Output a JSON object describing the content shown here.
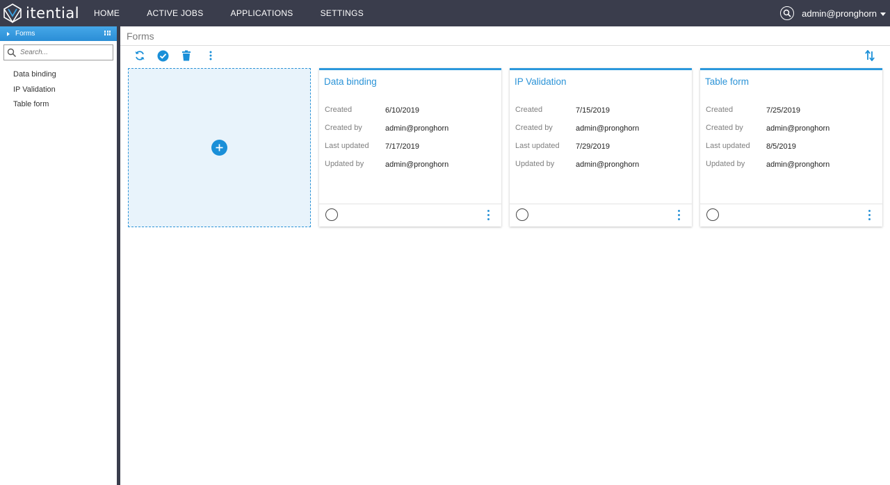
{
  "app": {
    "brand": "itential",
    "nav": [
      {
        "label": "HOME"
      },
      {
        "label": "ACTIVE JOBS"
      },
      {
        "label": "APPLICATIONS"
      },
      {
        "label": "SETTINGS"
      }
    ],
    "user": "admin@pronghorn"
  },
  "sidebar": {
    "header": "Forms",
    "search_placeholder": "Search...",
    "items": [
      {
        "label": "Data binding"
      },
      {
        "label": "IP Validation"
      },
      {
        "label": "Table form"
      }
    ]
  },
  "main": {
    "title": "Forms",
    "cards": [
      {
        "title": "Data binding",
        "created_label": "Created",
        "created": "6/10/2019",
        "created_by_label": "Created by",
        "created_by": "admin@pronghorn",
        "last_updated_label": "Last updated",
        "last_updated": "7/17/2019",
        "updated_by_label": "Updated by",
        "updated_by": "admin@pronghorn"
      },
      {
        "title": "IP Validation",
        "created_label": "Created",
        "created": "7/15/2019",
        "created_by_label": "Created by",
        "created_by": "admin@pronghorn",
        "last_updated_label": "Last updated",
        "last_updated": "7/29/2019",
        "updated_by_label": "Updated by",
        "updated_by": "admin@pronghorn"
      },
      {
        "title": "Table form",
        "created_label": "Created",
        "created": "7/25/2019",
        "created_by_label": "Created by",
        "created_by": "admin@pronghorn",
        "last_updated_label": "Last updated",
        "last_updated": "8/5/2019",
        "updated_by_label": "Updated by",
        "updated_by": "admin@pronghorn"
      }
    ]
  },
  "colors": {
    "topbar": "#3a3d4c",
    "accent": "#2b93d7",
    "add_card_bg": "#e8f3fb"
  },
  "icons": {
    "toolbar": [
      "refresh-icon",
      "check-circle-icon",
      "trash-icon",
      "more-vertical-icon"
    ],
    "sort": "sort-icon"
  }
}
